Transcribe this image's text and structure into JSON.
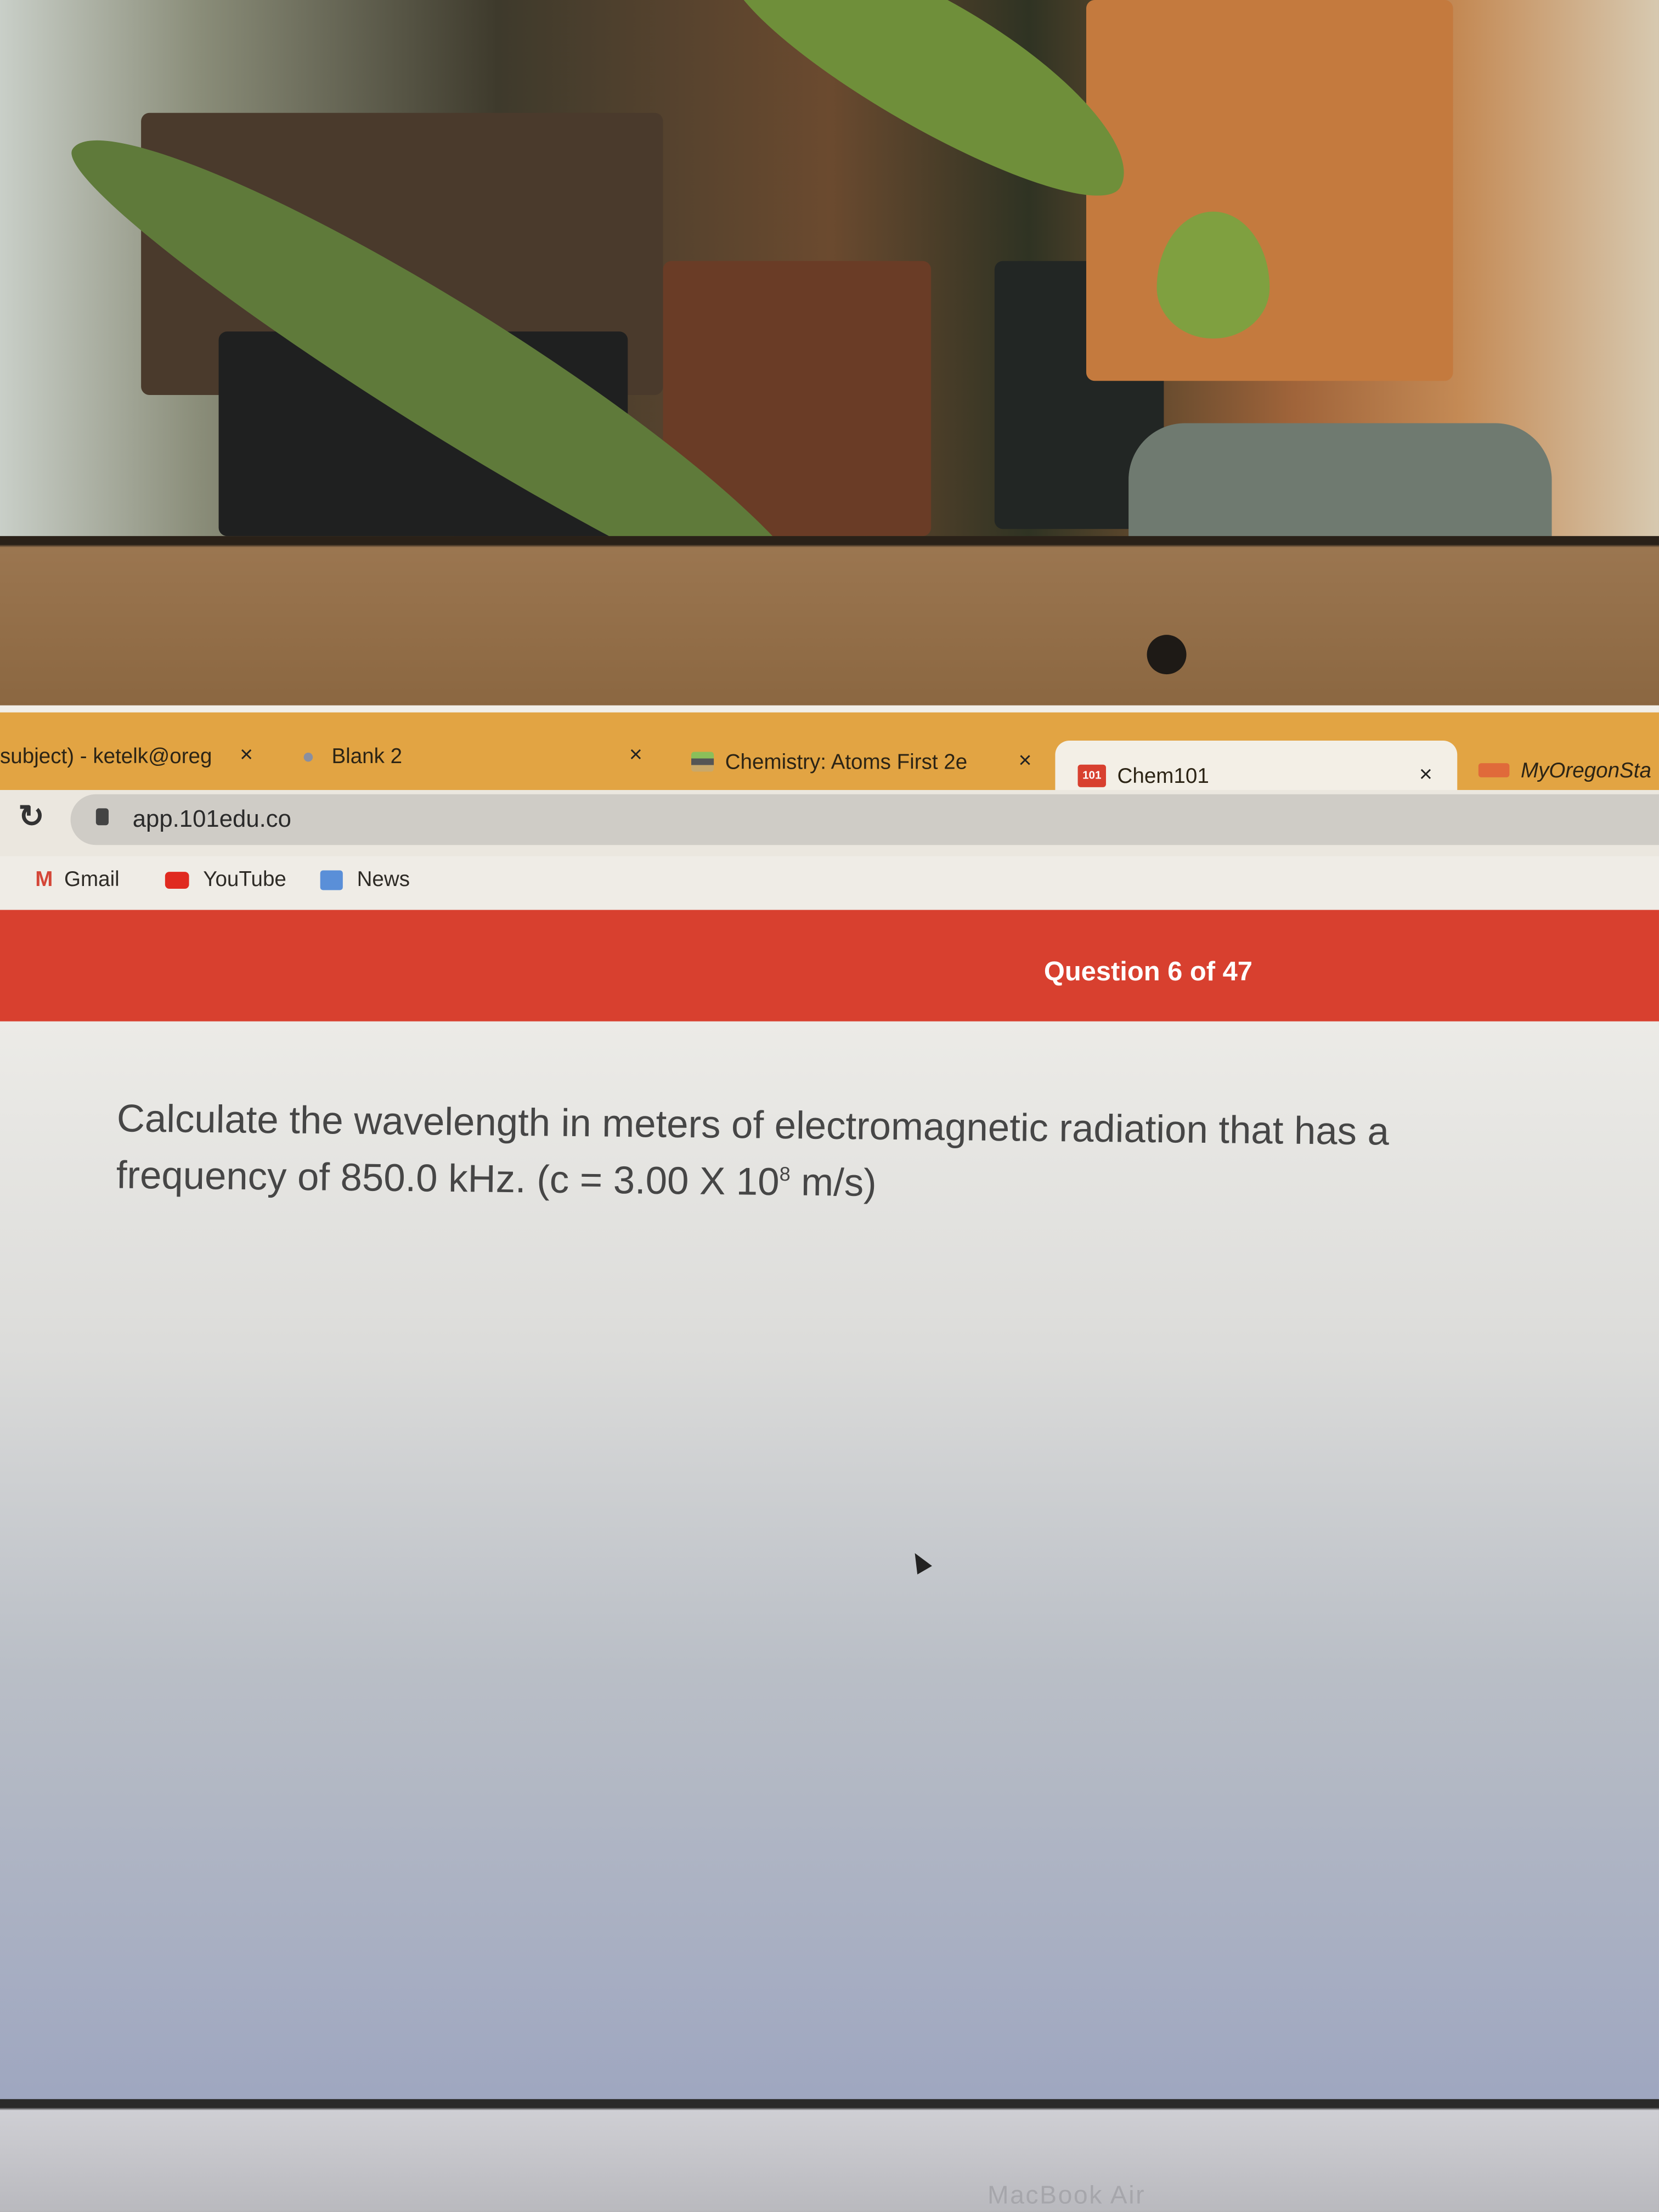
{
  "tabs": [
    {
      "label": "subject) - ketelk@oreg",
      "icon": "mail-icon",
      "active": false
    },
    {
      "label": "Blank 2",
      "icon": "apple-icon",
      "active": false
    },
    {
      "label": "Chemistry: Atoms First 2e",
      "icon": "book-icon",
      "active": false
    },
    {
      "label": "Chem101",
      "icon": "chem101-icon",
      "active": true
    },
    {
      "label": "MyOregonSta",
      "icon": "osu-icon",
      "active": false
    }
  ],
  "close_glyph": "×",
  "address": {
    "url": "app.101edu.co"
  },
  "bookmarks": [
    {
      "label": "Gmail",
      "icon": "gmail-icon"
    },
    {
      "label": "YouTube",
      "icon": "youtube-icon"
    },
    {
      "label": "News",
      "icon": "news-icon"
    }
  ],
  "header": {
    "progress": "Question 6 of 47"
  },
  "question": {
    "text_before": "Calculate the wavelength in meters of electromagnetic radiation that has a frequency of 850.0 kHz. (c = 3.00 X 10",
    "exponent": "8",
    "text_after": " m/s)"
  },
  "colors": {
    "tabstrip": "#e2a443",
    "header": "#d8402f",
    "chem101": "#d8402f"
  },
  "device_brand": "MacBook Air"
}
